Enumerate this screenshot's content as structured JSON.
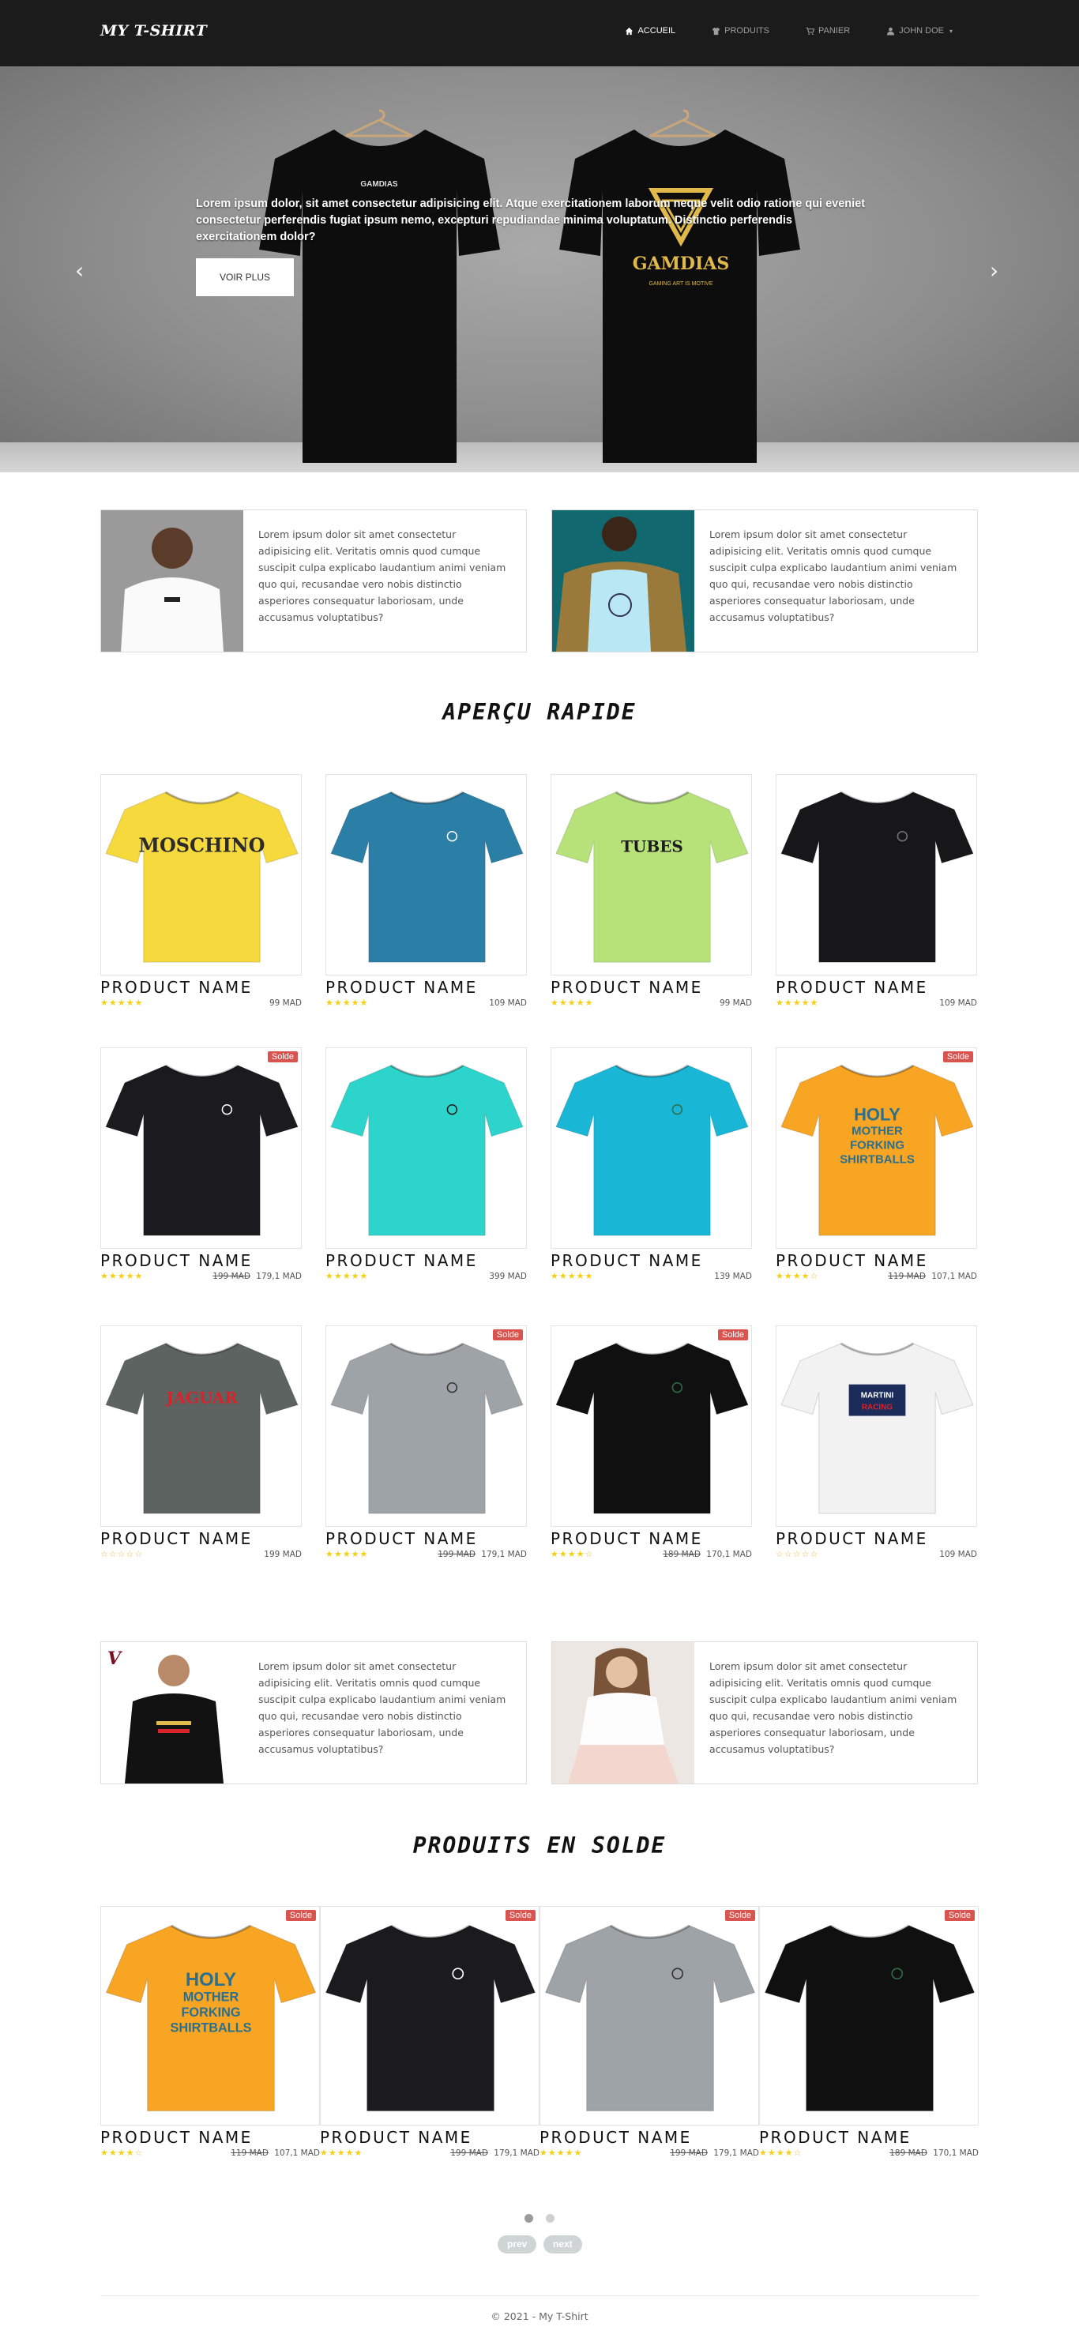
{
  "brand": "MY T-SHIRT",
  "nav": [
    {
      "label": "ACCUEIL",
      "icon": "home-icon",
      "active": true
    },
    {
      "label": "PRODUITS",
      "icon": "tshirt-icon",
      "active": false
    },
    {
      "label": "PANIER",
      "icon": "cart-icon",
      "active": false
    },
    {
      "label": "JOHN DOE",
      "icon": "user-icon",
      "active": false,
      "dropdown": true
    }
  ],
  "hero": {
    "text": "Lorem ipsum dolor, sit amet consectetur adipisicing elit. Atque exercitationem laborum neque velit odio ratione qui eveniet consectetur perferendis fugiat ipsum nemo, excepturi repudiandae minima voluptatum. Distinctio perferendis exercitationem dolor?",
    "button": "VOIR PLUS",
    "shirt_print_left": "GAMDIAS",
    "shirt_print_right": "GAMDIAS",
    "shirt_tagline_right": "GAMING ART IS MOTIVE"
  },
  "features_top": [
    {
      "text": "Lorem ipsum dolor sit amet consectetur adipisicing elit. Veritatis omnis quod cumque suscipit culpa explicabo laudantium animi veniam quo qui, recusandae vero nobis distinctio asperiores consequatur laboriosam, unde accusamus voluptatibus?"
    },
    {
      "text": "Lorem ipsum dolor sit amet consectetur adipisicing elit. Veritatis omnis quod cumque suscipit culpa explicabo laudantium animi veniam quo qui, recusandae vero nobis distinctio asperiores consequatur laboriosam, unde accusamus voluptatibus?"
    }
  ],
  "quick_title": "APERÇU RAPIDE",
  "products": [
    {
      "name": "PRODUCT NAME",
      "price": "99 MAD",
      "old": "",
      "rating": 5,
      "sale": false,
      "color": "#f6d93c",
      "print": "MOSCHINO",
      "print_color": "#2b2b2b"
    },
    {
      "name": "PRODUCT NAME",
      "price": "109 MAD",
      "old": "",
      "rating": 5,
      "sale": false,
      "color": "#2b7fa6",
      "print": "",
      "print_color": "#ffffff"
    },
    {
      "name": "PRODUCT NAME",
      "price": "99 MAD",
      "old": "",
      "rating": 5,
      "sale": false,
      "color": "#b7e27a",
      "print": "TUBES",
      "print_color": "#1c1c1c"
    },
    {
      "name": "PRODUCT NAME",
      "price": "109 MAD",
      "old": "",
      "rating": 5,
      "sale": false,
      "color": "#17171a",
      "print": "",
      "print_color": "#777777"
    },
    {
      "name": "PRODUCT NAME",
      "price": "179,1 MAD",
      "old": "199 MAD",
      "rating": 5,
      "sale": true,
      "color": "#1b1b1f",
      "print": "",
      "print_color": "#ffffff"
    },
    {
      "name": "PRODUCT NAME",
      "price": "399 MAD",
      "old": "",
      "rating": 5,
      "sale": false,
      "color": "#2dd4cb",
      "print": "",
      "print_color": "#1a1a1a"
    },
    {
      "name": "PRODUCT NAME",
      "price": "139 MAD",
      "old": "",
      "rating": 5,
      "sale": false,
      "color": "#1ab6d6",
      "print": "",
      "print_color": "#2f6d45"
    },
    {
      "name": "PRODUCT NAME",
      "price": "107,1 MAD",
      "old": "119 MAD",
      "rating": 4,
      "sale": true,
      "color": "#f7a523",
      "print": "HOLY MOTHER FORKING SHIRTBALLS",
      "print_color": "#2b6f8f"
    },
    {
      "name": "PRODUCT NAME",
      "price": "199 MAD",
      "old": "",
      "rating": 0,
      "sale": false,
      "color": "#5d6360",
      "print": "JAGUAR",
      "print_color": "#d8232a"
    },
    {
      "name": "PRODUCT NAME",
      "price": "179,1 MAD",
      "old": "199 MAD",
      "rating": 5,
      "sale": true,
      "color": "#9ea3a8",
      "print": "",
      "print_color": "#333333"
    },
    {
      "name": "PRODUCT NAME",
      "price": "170,1 MAD",
      "old": "189 MAD",
      "rating": 4,
      "sale": true,
      "color": "#101010",
      "print": "",
      "print_color": "#2f6d45"
    },
    {
      "name": "PRODUCT NAME",
      "price": "109 MAD",
      "old": "",
      "rating": 0,
      "sale": false,
      "color": "#f2f2f2",
      "print": "MARTINI RACING",
      "print_color": "#d8232a"
    }
  ],
  "sale_badge": "Solde",
  "features_bottom": [
    {
      "text": "Lorem ipsum dolor sit amet consectetur adipisicing elit. Veritatis omnis quod cumque suscipit culpa explicabo laudantium animi veniam quo qui, recusandae vero nobis distinctio asperiores consequatur laboriosam, unde accusamus voluptatibus?"
    },
    {
      "text": "Lorem ipsum dolor sit amet consectetur adipisicing elit. Veritatis omnis quod cumque suscipit culpa explicabo laudantium animi veniam quo qui, recusandae vero nobis distinctio asperiores consequatur laboriosam, unde accusamus voluptatibus?"
    }
  ],
  "sale_title": "PRODUITS EN SOLDE",
  "sale_products": [
    {
      "name": "PRODUCT NAME",
      "price": "107,1 MAD",
      "old": "119 MAD",
      "rating": 4,
      "color": "#f7a523",
      "print": "HOLY MOTHER FORKING SHIRTBALLS",
      "print_color": "#2b6f8f"
    },
    {
      "name": "PRODUCT NAME",
      "price": "179,1 MAD",
      "old": "199 MAD",
      "rating": 5,
      "color": "#1b1b1f",
      "print": "",
      "print_color": "#ffffff"
    },
    {
      "name": "PRODUCT NAME",
      "price": "179,1 MAD",
      "old": "199 MAD",
      "rating": 5,
      "color": "#9ea3a8",
      "print": "",
      "print_color": "#333333"
    },
    {
      "name": "PRODUCT NAME",
      "price": "170,1 MAD",
      "old": "189 MAD",
      "rating": 4,
      "color": "#101010",
      "print": "",
      "print_color": "#2f6d45"
    }
  ],
  "carousel": {
    "prev": "prev",
    "next": "next",
    "active_dot": 0
  },
  "footer": "© 2021 - My T-Shirt"
}
